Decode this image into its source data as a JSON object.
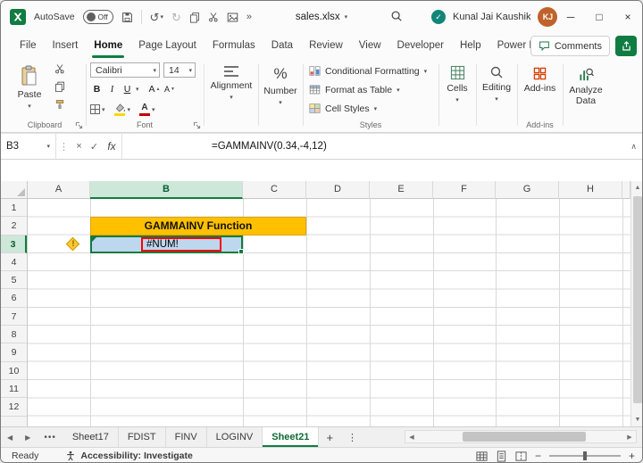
{
  "titlebar": {
    "autosave_label": "AutoSave",
    "autosave_state": "Off",
    "filename": "sales.xlsx",
    "user_name": "Kunal Jai Kaushik",
    "user_initials": "KJ"
  },
  "tabs": {
    "items": [
      "File",
      "Insert",
      "Home",
      "Page Layout",
      "Formulas",
      "Data",
      "Review",
      "View",
      "Developer",
      "Help",
      "Power Pivot"
    ],
    "comments_label": "Comments"
  },
  "ribbon": {
    "paste_label": "Paste",
    "clipboard_group": "Clipboard",
    "font_family": "Calibri",
    "font_size": "14",
    "bold": "B",
    "italic": "I",
    "underline": "U",
    "letter_a": "A",
    "font_group": "Font",
    "alignment_label": "Alignment",
    "number_label": "Number",
    "percent_sign": "%",
    "styles_items": [
      "Conditional Formatting",
      "Format as Table",
      "Cell Styles"
    ],
    "styles_group": "Styles",
    "cells_label": "Cells",
    "editing_label": "Editing",
    "addins_label": "Add-ins",
    "addins_group": "Add-ins",
    "analyze_label": "Analyze Data"
  },
  "formula_bar": {
    "name_box": "B3",
    "fx_label": "fx",
    "formula": "=GAMMAINV(0.34,-4,12)"
  },
  "grid": {
    "columns": [
      "A",
      "B",
      "C",
      "D",
      "E",
      "F",
      "G",
      "H"
    ],
    "rows": [
      "1",
      "2",
      "3",
      "4",
      "5",
      "6",
      "7",
      "8",
      "9",
      "10",
      "11",
      "12"
    ],
    "banner_text": "GAMMAINV Function",
    "error_text": "#NUM!",
    "warning_mark": "!",
    "selected_cell": "B3"
  },
  "sheet_tabs": {
    "items": [
      "Sheet17",
      "FDIST",
      "FINV",
      "LOGINV",
      "Sheet21"
    ],
    "active": "Sheet21"
  },
  "status_bar": {
    "ready_label": "Ready",
    "accessibility_label": "Accessibility: Investigate"
  },
  "icons": {
    "dropdown": "▾",
    "undo": "↺",
    "redo": "↻",
    "more": "»",
    "handle_dots": "⋮",
    "cancel": "×",
    "confirm": "✓",
    "collapse": "∧",
    "prev": "◀",
    "next": "▶",
    "up": "▲",
    "down": "▼",
    "ellipsis": "•••",
    "add": "+",
    "zoom_out": "−",
    "zoom_in": "+",
    "minimize": "─",
    "maximize": "□",
    "close": "×"
  },
  "colors": {
    "accent_green": "#107C41",
    "banner_gold": "#FFC000",
    "error_cell_blue": "#BDD7EE",
    "error_box_red": "#FF0000",
    "avatar_orange": "#C0622C",
    "presence_teal": "#128578"
  }
}
